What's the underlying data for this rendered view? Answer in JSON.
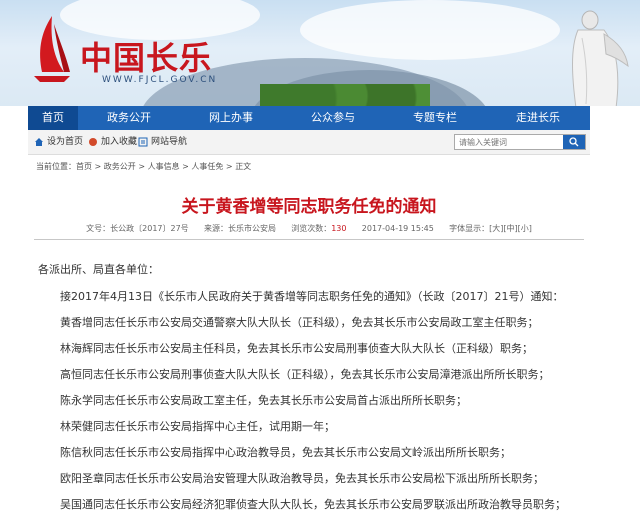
{
  "site": {
    "name": "中国长乐",
    "url": "WWW.FJCL.GOV.CN"
  },
  "nav": [
    {
      "label": "首页",
      "active": true
    },
    {
      "label": "政务公开",
      "active": false
    },
    {
      "label": "网上办事",
      "active": false
    },
    {
      "label": "公众参与",
      "active": false
    },
    {
      "label": "专题专栏",
      "active": false
    },
    {
      "label": "走进长乐",
      "active": false
    }
  ],
  "toolbar": {
    "homepage": "设为首页",
    "favorite": "加入收藏",
    "site_nav": "网站导航",
    "search_placeholder": "请输入关键词"
  },
  "breadcrumb": {
    "prefix": "当前位置：",
    "items": [
      "首页",
      "政务公开",
      "人事信息",
      "人事任免",
      "正文"
    ]
  },
  "article": {
    "title": "关于黄香增等同志职务任免的通知",
    "meta": {
      "doc_no": "文号：长公政〔2017〕27号",
      "source": "来源：长乐市公安局",
      "views_label": "浏览次数：",
      "views": "130",
      "date": "2017-04-19 15:45",
      "font_size": "字体显示：[大][中][小]"
    },
    "paragraphs": [
      "各派出所、局直各单位：",
      "接2017年4月13日《长乐市人民政府关于黄香增等同志职务任免的通知》（长政〔2017〕21号）通知：",
      "黄香增同志任长乐市公安局交通警察大队大队长（正科级），免去其长乐市公安局政工室主任职务；",
      "林海辉同志任长乐市公安局主任科员，免去其长乐市公安局刑事侦查大队大队长（正科级）职务；",
      "高恒同志任长乐市公安局刑事侦查大队大队长（正科级），免去其长乐市公安局漳港派出所所长职务；",
      "陈永学同志任长乐市公安局政工室主任，免去其长乐市公安局首占派出所所长职务；",
      "林荣健同志任长乐市公安局指挥中心主任，试用期一年；",
      "陈信秋同志任长乐市公安局指挥中心政治教导员，免去其长乐市公安局文岭派出所所长职务；",
      "欧阳圣章同志任长乐市公安局治安管理大队政治教导员，免去其长乐市公安局松下派出所所长职务；",
      "吴国通同志任长乐市公安局经济犯罪侦查大队大队长，免去其长乐市公安局罗联派出所政治教导员职务；"
    ]
  },
  "colors": {
    "brand_red": "#c8161e",
    "nav_blue": "#1f64b6",
    "nav_active": "#0f4a92"
  }
}
